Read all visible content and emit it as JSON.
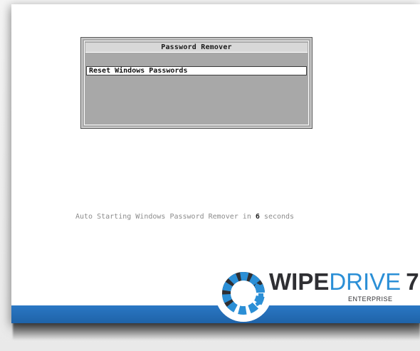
{
  "menu": {
    "title": "Password Remover",
    "items": [
      {
        "label": "Reset Windows Passwords",
        "selected": true
      }
    ]
  },
  "status": {
    "prefix": "Auto Starting Windows Password Remover in ",
    "seconds": "6",
    "suffix": " seconds"
  },
  "brand": {
    "logo_icon": "wipedrive-ring-logo-icon",
    "wordmark_wipe": "WIPE",
    "wordmark_drive": "DRIVE",
    "version": "7",
    "edition": "ENTERPRISE",
    "colors": {
      "accent_blue": "#2b8fd6",
      "footer_blue": "#1f63a8",
      "dark": "#2f2f33"
    }
  }
}
